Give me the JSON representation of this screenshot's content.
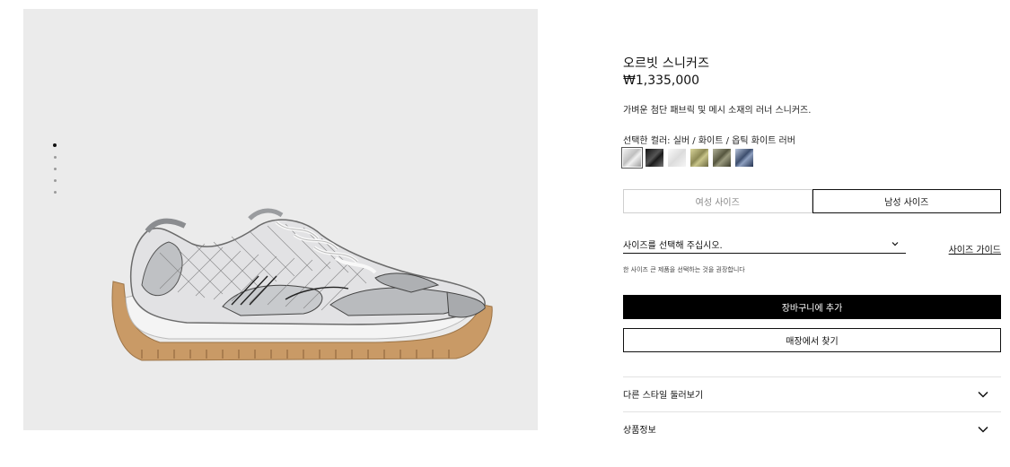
{
  "product": {
    "title": "오르빗 스니커즈",
    "price": "₩1,335,000",
    "description": "가벼운 첨단 패브릭 및 메시 소재의 러너 스니커즈.",
    "selected_color_label": "선택한 컬러: 실버 / 화이트 / 옵틱 화이트 러버"
  },
  "swatches": [
    {
      "name": "silver-white",
      "color": "#d9d9d9"
    },
    {
      "name": "black",
      "color": "#2a2a2a"
    },
    {
      "name": "white",
      "color": "#ececec"
    },
    {
      "name": "olive-yellow",
      "color": "#a7a470"
    },
    {
      "name": "camo-green",
      "color": "#6f6f55"
    },
    {
      "name": "navy-blue",
      "color": "#4e5f7e"
    }
  ],
  "size_tabs": {
    "women": "여성 사이즈",
    "men": "남성 사이즈"
  },
  "size_select": {
    "placeholder": "사이즈를 선택해 주십시오.",
    "guide_link": "사이즈 가이드",
    "hint": "한 사이즈 큰 제품을 선택하는 것을 권장합니다"
  },
  "buttons": {
    "add_to_cart": "장바구니에 추가",
    "find_in_store": "매장에서 찾기"
  },
  "accordions": {
    "other_styles": "다른 스타일 둘러보기",
    "product_info": "상품정보"
  },
  "gallery": {
    "dot_count": 5,
    "active_dot": 0
  }
}
